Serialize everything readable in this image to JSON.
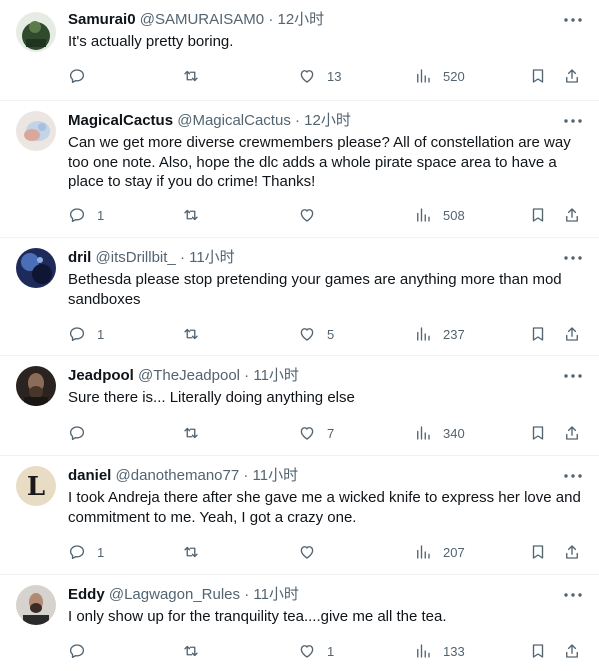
{
  "tweets": [
    {
      "name": "Samurai0",
      "handle": "@SAMURAISAM0",
      "dot": "·",
      "time": "12小时",
      "text": "It's actually pretty boring.",
      "replies": "",
      "retweets": "",
      "likes": "13",
      "views": "520",
      "avatar_icon": "avatar-photo",
      "avatar_color": "#3d5a3a"
    },
    {
      "name": "MagicalCactus",
      "handle": "@MagicalCactus",
      "dot": "·",
      "time": "12小时",
      "text": "Can we get more diverse crewmembers please? All of constellation are way too one note. Also, hope the dlc adds a whole pirate space area to have a place to stay if you do crime! Thanks!",
      "replies": "1",
      "retweets": "",
      "likes": "",
      "views": "508",
      "avatar_icon": "avatar-photo",
      "avatar_color": "#c9b8b0"
    },
    {
      "name": "dril",
      "handle": "@itsDrillbit_",
      "dot": "·",
      "time": "11小时",
      "text": "Bethesda please stop pretending your games are anything more than mod sandboxes",
      "replies": "1",
      "retweets": "",
      "likes": "5",
      "views": "237",
      "avatar_icon": "avatar-photo",
      "avatar_color": "#2a3b6e"
    },
    {
      "name": "Jeadpool",
      "handle": "@TheJeadpool",
      "dot": "·",
      "time": "11小时",
      "text": "Sure there is... Literally doing anything else",
      "replies": "",
      "retweets": "",
      "likes": "7",
      "views": "340",
      "avatar_icon": "avatar-photo",
      "avatar_color": "#3a2f28"
    },
    {
      "name": "daniel",
      "handle": "@danothemano77",
      "dot": "·",
      "time": "11小时",
      "text": "I took Andreja there after she gave me a wicked knife to express her love and commitment to me. Yeah, I got a crazy one.",
      "replies": "1",
      "retweets": "",
      "likes": "",
      "views": "207",
      "avatar_icon": "avatar-letter-l",
      "avatar_letter": "L",
      "avatar_color": "#e8dcc4"
    },
    {
      "name": "Eddy",
      "handle": "@Lagwagon_Rules",
      "dot": "·",
      "time": "11小时",
      "text": "I only show up for the tranquility tea....give me all the tea.",
      "replies": "",
      "retweets": "",
      "likes": "1",
      "views": "133",
      "avatar_icon": "avatar-photo",
      "avatar_color": "#c7c2bc"
    }
  ]
}
